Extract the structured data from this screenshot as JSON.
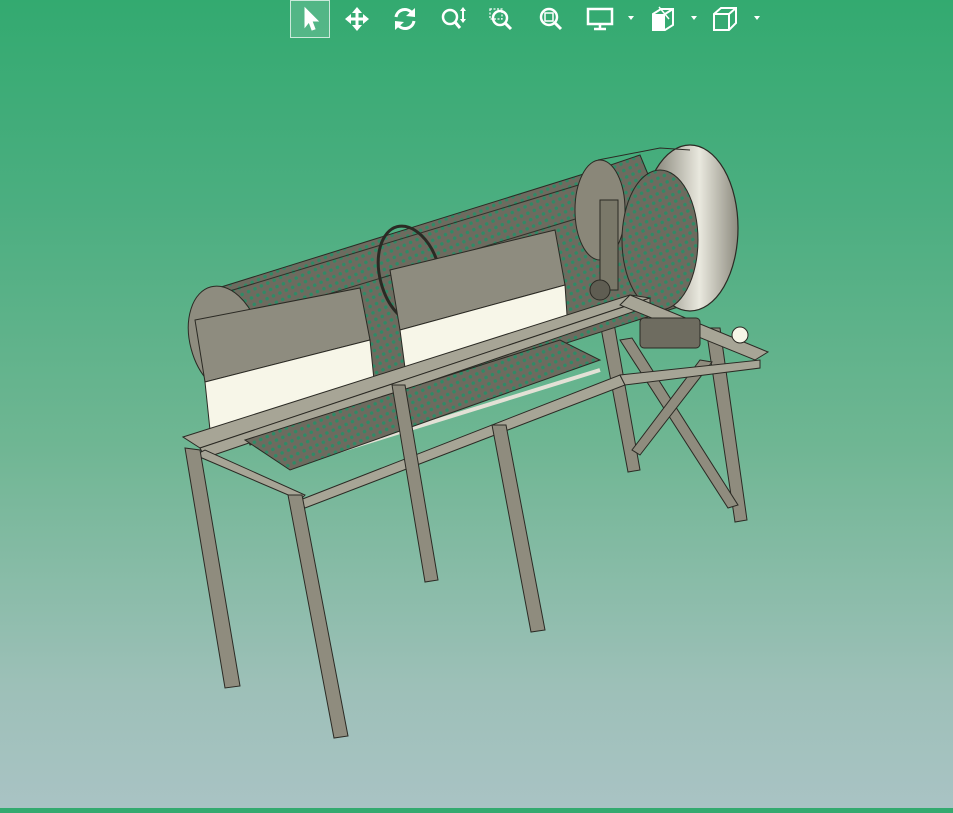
{
  "toolbar": {
    "items": [
      {
        "name": "select-arrow-icon",
        "tool": "select",
        "active": true
      },
      {
        "name": "pan-move-icon",
        "tool": "pan"
      },
      {
        "name": "rotate-icon",
        "tool": "rotate"
      },
      {
        "name": "zoom-up-down-icon",
        "tool": "zoom"
      },
      {
        "name": "zoom-window-icon",
        "tool": "zoom-window"
      },
      {
        "name": "zoom-fit-icon",
        "tool": "zoom-fit"
      },
      {
        "name": "display-mode-icon",
        "tool": "display",
        "dropdown": true
      },
      {
        "name": "section-view-icon",
        "tool": "views",
        "dropdown": true
      },
      {
        "name": "standard-view-cube-icon",
        "tool": "standard-views",
        "dropdown": true
      }
    ]
  },
  "model": {
    "description_hidden": "",
    "colors": {
      "metal": "#8a8779",
      "metal_dark": "#5f5d52",
      "metal_light": "#c9c6b7",
      "panel_white": "#f7f6e8",
      "edge": "#2b2a24",
      "background_top": "#33aa70",
      "background_bottom": "#a9c3c4"
    }
  }
}
